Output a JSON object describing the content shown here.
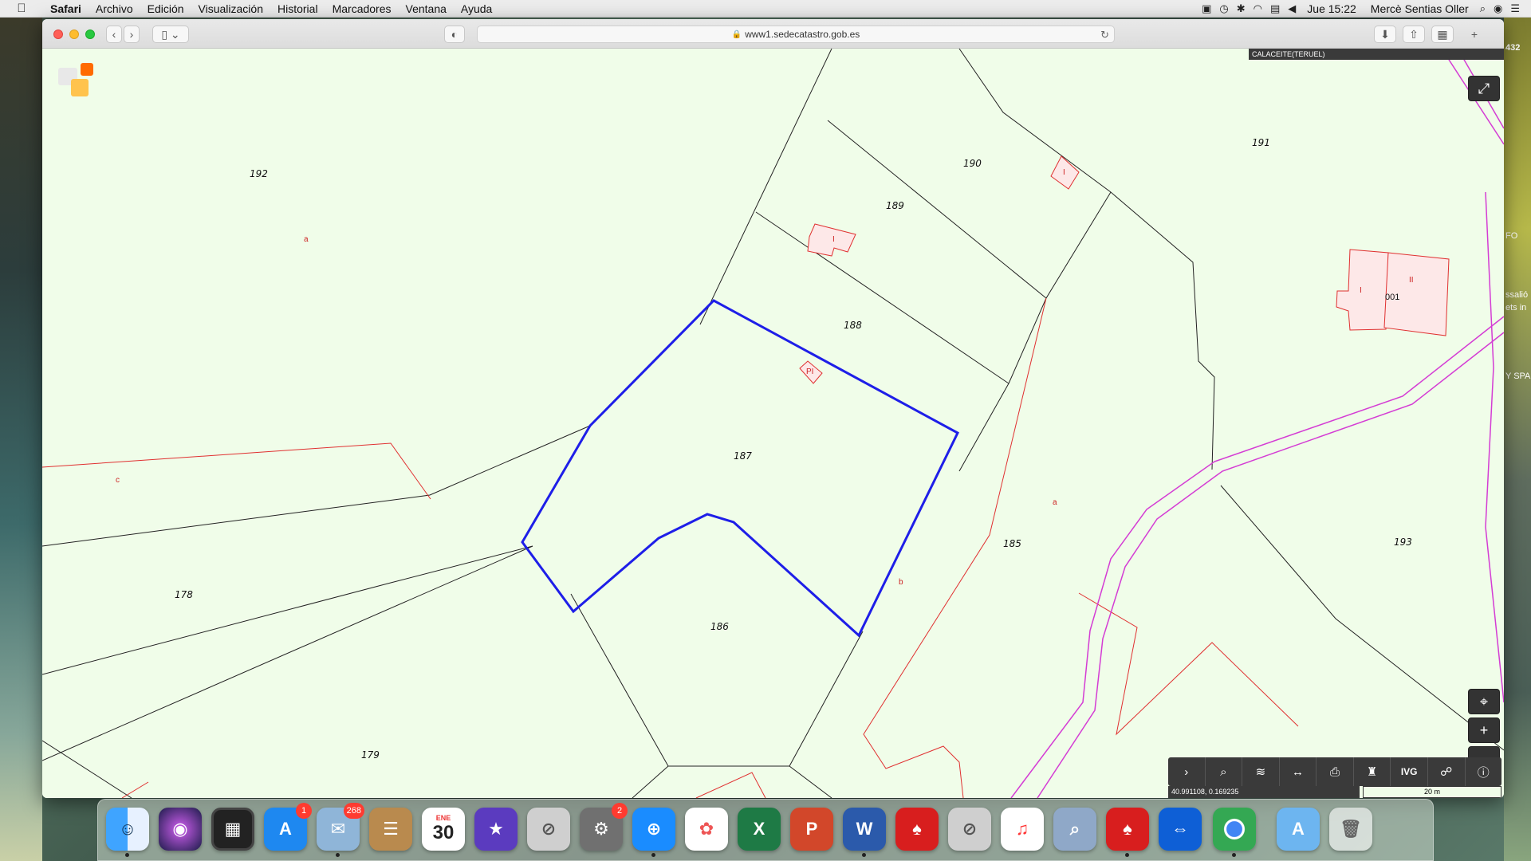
{
  "menubar": {
    "apple": "",
    "app_name": "Safari",
    "items": [
      "Archivo",
      "Edición",
      "Visualización",
      "Historial",
      "Marcadores",
      "Ventana",
      "Ayuda"
    ],
    "clock": "Jue 15:22",
    "user": "Mercè Sentias Oller"
  },
  "browser": {
    "url": "www1.sedecatastro.gob.es"
  },
  "map": {
    "municipality": "CALACEITE(TERUEL)",
    "parcels": [
      "192",
      "191",
      "190",
      "189",
      "188",
      "187",
      "186",
      "185",
      "178",
      "179",
      "193"
    ],
    "subparcels": [
      "a",
      "c",
      "a",
      "b"
    ],
    "buildings": [
      "I",
      "I",
      "PI",
      "I",
      "II",
      "001"
    ],
    "coords": "40.991108, 0.169235",
    "scale": "20 m",
    "tools": [
      "expand-tool",
      "search-tool",
      "layers-tool",
      "measure-tool",
      "print-tool",
      "legend-tool",
      "ivg-tool",
      "share-tool",
      "info-tool"
    ],
    "ivg_label": "IVG",
    "edge_number": "432"
  },
  "desktop_right_texts": [
    "FO",
    "ssalió",
    "ets in",
    "Y SPA"
  ],
  "dock": {
    "apps": [
      {
        "name": "finder",
        "badge": ""
      },
      {
        "name": "siri",
        "badge": ""
      },
      {
        "name": "photo-booth",
        "badge": ""
      },
      {
        "name": "app-store",
        "badge": "1"
      },
      {
        "name": "mail",
        "badge": "268"
      },
      {
        "name": "contacts",
        "badge": ""
      },
      {
        "name": "calendar",
        "badge": "",
        "month": "ENE",
        "day": "30"
      },
      {
        "name": "imovie",
        "badge": ""
      },
      {
        "name": "blocked-app",
        "badge": ""
      },
      {
        "name": "system-preferences",
        "badge": "2"
      },
      {
        "name": "safari",
        "badge": ""
      },
      {
        "name": "photos",
        "badge": ""
      },
      {
        "name": "excel",
        "badge": ""
      },
      {
        "name": "powerpoint",
        "badge": ""
      },
      {
        "name": "word",
        "badge": ""
      },
      {
        "name": "acrobat",
        "badge": ""
      },
      {
        "name": "blocked-app-2",
        "badge": ""
      },
      {
        "name": "music",
        "badge": ""
      },
      {
        "name": "preview",
        "badge": ""
      },
      {
        "name": "acrobat-2",
        "badge": ""
      },
      {
        "name": "teamviewer",
        "badge": ""
      },
      {
        "name": "chrome",
        "badge": ""
      },
      {
        "name": "applications-folder",
        "badge": ""
      },
      {
        "name": "trash",
        "badge": ""
      }
    ]
  }
}
